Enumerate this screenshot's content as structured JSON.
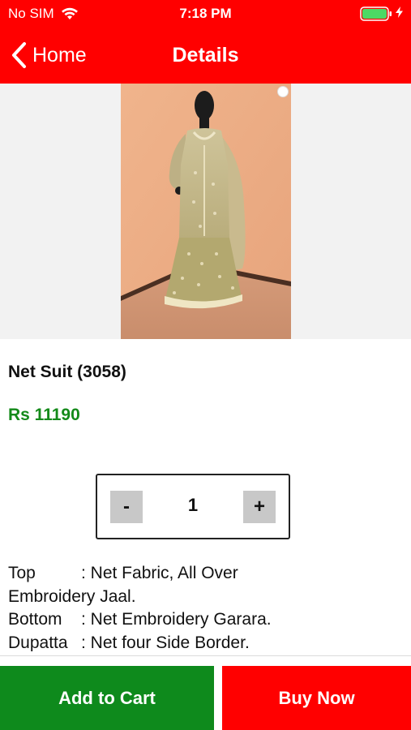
{
  "status_bar": {
    "carrier": "No SIM",
    "time": "7:18 PM",
    "wifi_icon": "wifi-icon",
    "battery_icon": "battery-icon",
    "charging_icon": "bolt-icon"
  },
  "nav": {
    "back_icon": "chevron-left-icon",
    "back_label": "Home",
    "title": "Details"
  },
  "product": {
    "name": "Net Suit (3058)",
    "price": "Rs 11190",
    "quantity": "1",
    "minus_label": "-",
    "plus_label": "+",
    "description": [
      {
        "key": "Top",
        "value": ": Net Fabric, All Over"
      },
      {
        "key": "",
        "value": "Embroidery Jaal."
      },
      {
        "key": "Bottom",
        "value": ": Net Embroidery Garara."
      },
      {
        "key": "Dupatta",
        "value": ": Net four Side Border."
      }
    ]
  },
  "actions": {
    "add_to_cart": "Add to Cart",
    "buy_now": "Buy Now"
  },
  "colors": {
    "brand_red": "#ff0000",
    "price_green": "#148a1a",
    "cart_green": "#0e8a1c"
  }
}
